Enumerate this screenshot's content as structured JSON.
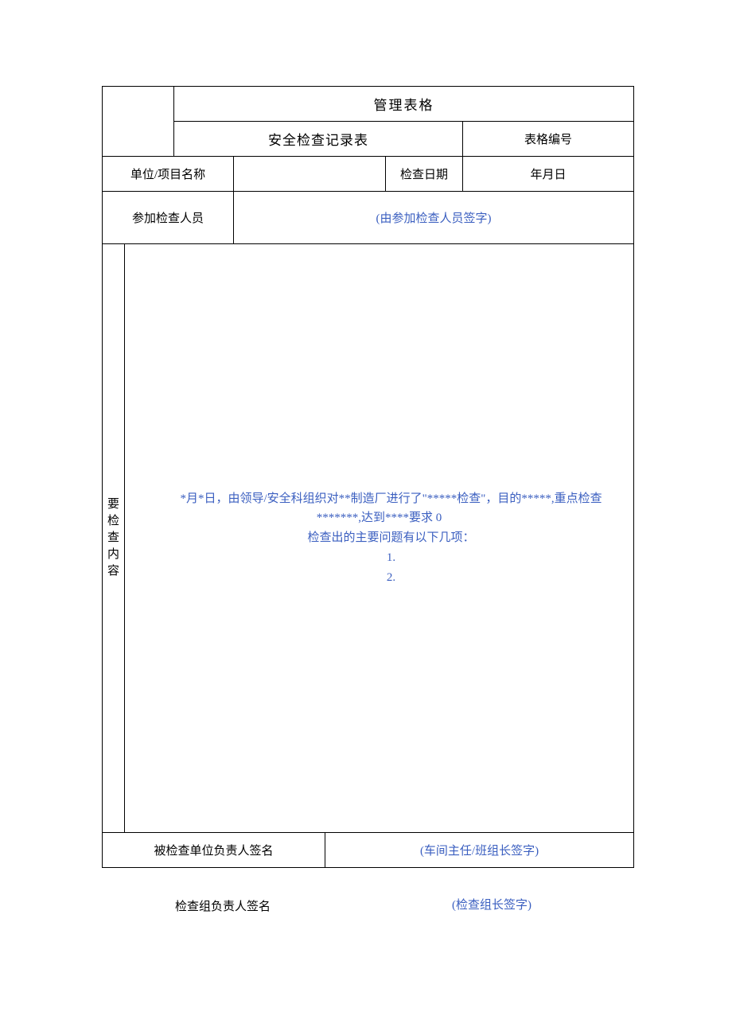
{
  "header": {
    "title_main": "管理表格",
    "title_sub": "安全检查记录表",
    "form_number_label": "表格编号"
  },
  "row_unit": {
    "label": "单位/项目名称",
    "value": "",
    "date_label": "检查日期",
    "date_value": "年月日"
  },
  "row_participants": {
    "label": "参加检查人员",
    "hint": "(由参加检查人员签字)"
  },
  "content": {
    "side_label_1": "要",
    "side_label_2": "检",
    "side_label_3": "查",
    "side_label_4": "内",
    "side_label_5": "容",
    "line1_a": "*月*日，由领导/安全科组织对**制造厂进行了\"*****检查\"，目的*****,重点检查",
    "line2": "*******,达到****要求 0",
    "line3": "检查出的主要问题有以下几项：",
    "item1": "1.",
    "item2": "2."
  },
  "signature": {
    "left_label": "被检查单位负责人签名",
    "right_hint": "(车间主任/班组长签字)"
  },
  "footer": {
    "left_label": "检查组负责人签名",
    "right_hint": "(检查组长签字)"
  }
}
